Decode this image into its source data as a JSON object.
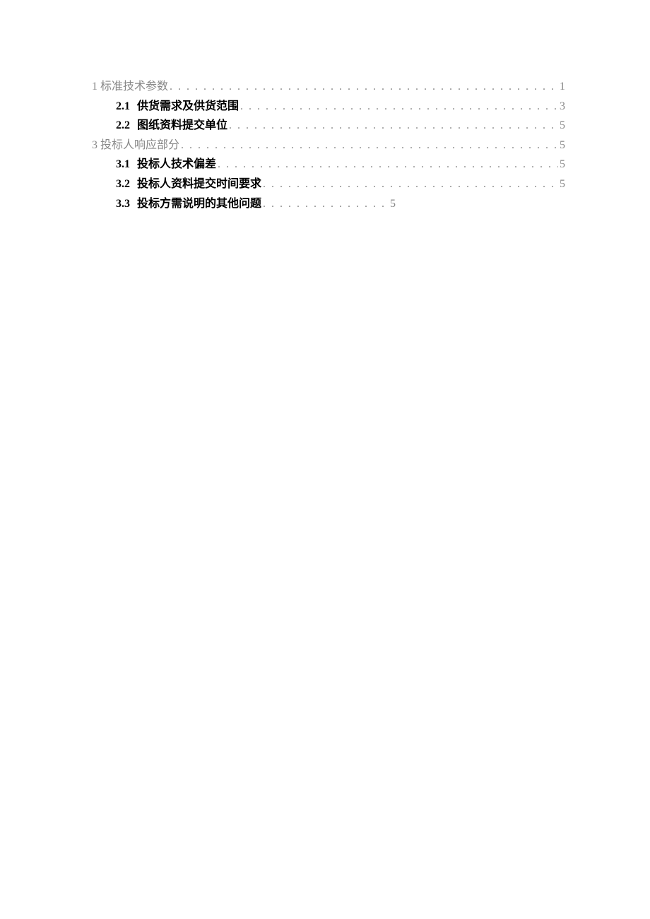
{
  "toc": [
    {
      "level": 1,
      "number": "1",
      "title": "标准技术参数",
      "page": "1",
      "short": false
    },
    {
      "level": 2,
      "number": "2.1",
      "title": "供货需求及供货范围",
      "page": "3",
      "short": false
    },
    {
      "level": 2,
      "number": "2.2",
      "title": "图纸资料提交单位",
      "page": "5",
      "short": false
    },
    {
      "level": 1,
      "number": "3",
      "title": "投标人响应部分",
      "page": "5",
      "short": false
    },
    {
      "level": 2,
      "number": "3.1",
      "title": "投标人技术偏差",
      "page": "5",
      "short": false
    },
    {
      "level": 2,
      "number": "3.2",
      "title": "投标人资料提交时间要求",
      "page": "5",
      "short": false
    },
    {
      "level": 2,
      "number": "3.3",
      "title": "投标方需说明的其他问题",
      "page": "5",
      "short": true
    }
  ]
}
